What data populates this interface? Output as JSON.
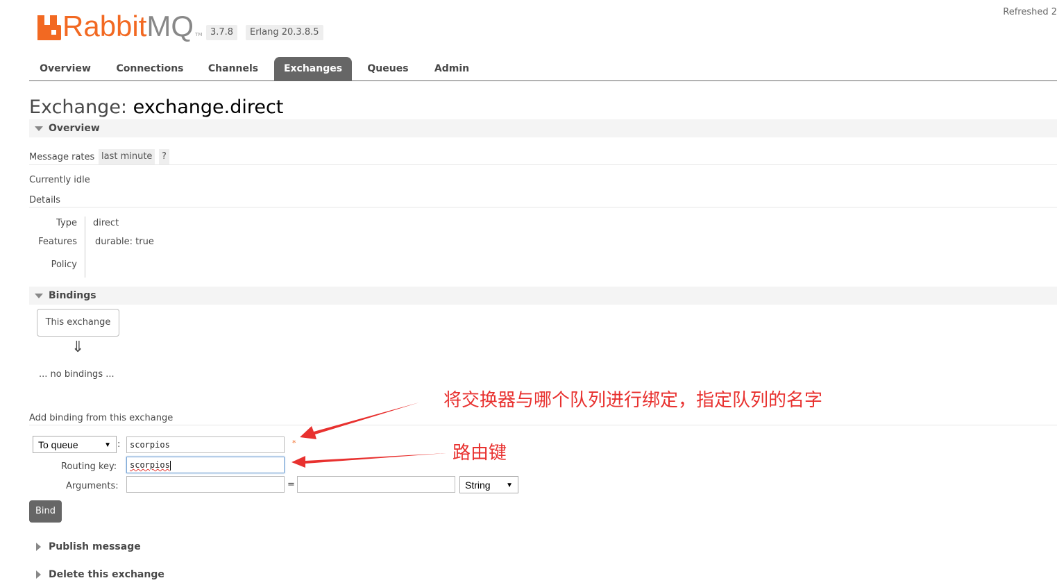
{
  "header": {
    "logo_rabbit": "Rabbit",
    "logo_mq": "MQ",
    "logo_tm": "TM",
    "version": "3.7.8",
    "erlang": "Erlang 20.3.8.5",
    "refreshed": "Refreshed 2"
  },
  "nav": {
    "tabs": [
      {
        "label": "Overview"
      },
      {
        "label": "Connections"
      },
      {
        "label": "Channels"
      },
      {
        "label": "Exchanges",
        "active": true
      },
      {
        "label": "Queues"
      },
      {
        "label": "Admin"
      }
    ]
  },
  "title": {
    "prefix": "Exchange: ",
    "name": "exchange.direct"
  },
  "overview": {
    "header": "Overview",
    "message_rates": "Message rates",
    "rate_period": "last minute",
    "help": "?",
    "currently_idle": "Currently idle",
    "details_label": "Details",
    "details": [
      {
        "key": "Type",
        "value": "direct"
      },
      {
        "key": "Features",
        "value": "durable: true"
      },
      {
        "key": "Policy",
        "value": ""
      }
    ]
  },
  "bindings": {
    "header": "Bindings",
    "this_exchange": "This exchange",
    "arrow": "⇓",
    "no_bindings": "... no bindings ...",
    "add_binding_label": "Add binding from this exchange",
    "destination_type": "To queue",
    "destination_value": "scorpios",
    "routing_key_label": "Routing key:",
    "routing_key_value": "scorpios",
    "arguments_label": "Arguments:",
    "arguments_key": "",
    "arguments_value": "",
    "equals": "=",
    "colon": ":",
    "arg_type": "String",
    "required_mark": "*",
    "bind_button": "Bind"
  },
  "sections_collapsed": [
    {
      "label": "Publish message"
    },
    {
      "label": "Delete this exchange"
    }
  ],
  "annotations": {
    "queue_note": "将交换器与哪个队列进行绑定，指定队列的名字",
    "routing_note": "路由键"
  },
  "colors": {
    "brand_orange": "#f26922",
    "tab_active": "#666666",
    "annotation_red": "#e8312f"
  }
}
